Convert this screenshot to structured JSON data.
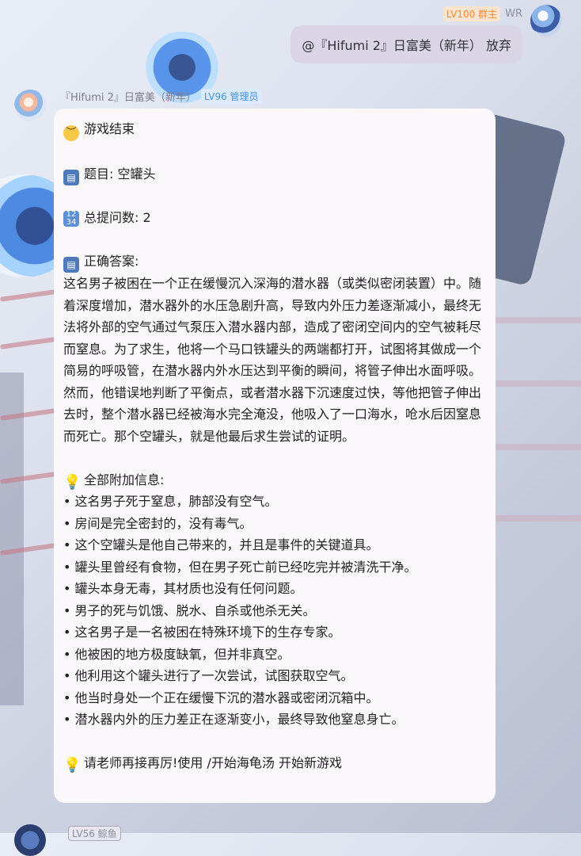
{
  "user": {
    "level_badge": "LV100 群主",
    "name": "WR",
    "message": "@『Hifumi 2』日富美（新年） 放弃"
  },
  "bot": {
    "name": "『Hifumi 2』日富美（新年）",
    "level_badge": "LV96 管理员",
    "lines": {
      "game_over": "游戏结束",
      "topic": "题目: 空罐头",
      "total_questions": "总提问数: 2",
      "answer_header": "正确答案:",
      "answer_body": "这名男子被困在一个正在缓慢沉入深海的潜水器（或类似密闭装置）中。随着深度增加，潜水器外的水压急剧升高，导致内外压力差逐渐减小，最终无法将外部的空气通过气泵压入潜水器内部，造成了密闭空间内的空气被耗尽而窒息。为了求生，他将一个马口铁罐头的两端都打开，试图将其做成一个简易的呼吸管，在潜水器内外水压达到平衡的瞬间，将管子伸出水面呼吸。然而，他错误地判断了平衡点，或者潜水器下沉速度过快，等他把管子伸出去时，整个潜水器已经被海水完全淹没，他吸入了一口海水，呛水后因窒息而死亡。那个空罐头，就是他最后求生尝试的证明。",
      "extra_header": "全部附加信息:",
      "extra_items": [
        "• 这名男子死于窒息，肺部没有空气。",
        "• 房间是完全密封的，没有毒气。",
        "• 这个空罐头是他自己带来的，并且是事件的关键道具。",
        "• 罐头里曾经有食物，但在男子死亡前已经吃完并被清洗干净。",
        "• 罐头本身无毒，其材质也没有任何问题。",
        "• 男子的死与饥饿、脱水、自杀或他杀无关。",
        "• 这名男子是一名被困在特殊环境下的生存专家。",
        "• 他被困的地方极度缺氧，但并非真空。",
        "• 他利用这个罐头进行了一次尝试，试图获取空气。",
        "• 他当时身处一个正在缓慢下沉的潜水器或密闭沉箱中。",
        "• 潜水器内外的压力差正在逐渐变小，最终导致他窒息身亡。"
      ],
      "footer": "请老师再接再厉!使用 /开始海龟汤 开始新游戏"
    },
    "icons": {
      "game_over": "pensive-face-icon",
      "topic": "open-book-icon",
      "count": "input-numbers-icon",
      "answer": "open-book-icon",
      "extra": "light-bulb-icon",
      "footer": "light-bulb-icon"
    }
  },
  "next_message": {
    "level_badge": "LV56 鲸鱼"
  }
}
